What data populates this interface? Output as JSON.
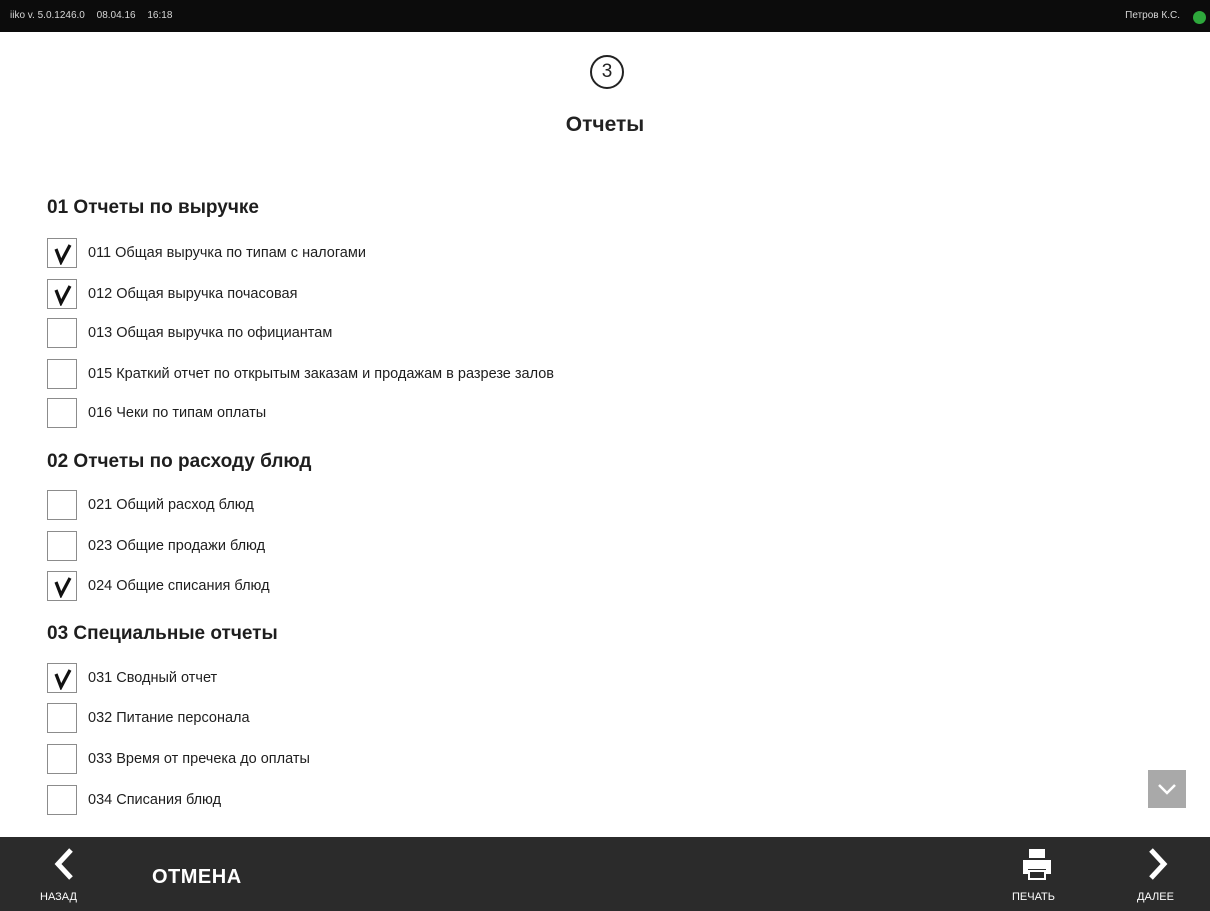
{
  "status_bar": {
    "app_version": "iiko v. 5.0.1246.0",
    "date": "08.04.16",
    "time": "16:18",
    "user": "Петров К.С.",
    "status_color": "#2ea83c"
  },
  "step": {
    "number": "3"
  },
  "page_title": "Отчеты",
  "groups": [
    {
      "title": "01 Отчеты по выручке",
      "items": [
        {
          "label": "011 Общая выручка по типам с налогами",
          "checked": true
        },
        {
          "label": "012 Общая выручка почасовая",
          "checked": true
        },
        {
          "label": "013 Общая выручка по официантам",
          "checked": false
        },
        {
          "label": "015 Краткий отчет по открытым заказам и продажам в разрезе залов",
          "checked": false
        },
        {
          "label": "016 Чеки по типам оплаты",
          "checked": false
        }
      ]
    },
    {
      "title": "02 Отчеты по расходу блюд",
      "items": [
        {
          "label": "021 Общий расход блюд",
          "checked": false
        },
        {
          "label": "023 Общие продажи блюд",
          "checked": false
        },
        {
          "label": "024 Общие списания блюд",
          "checked": true
        }
      ]
    },
    {
      "title": "03 Специальные отчеты",
      "items": [
        {
          "label": "031 Сводный отчет",
          "checked": true
        },
        {
          "label": "032 Питание персонала",
          "checked": false
        },
        {
          "label": "033 Время от пречека до оплаты",
          "checked": false
        },
        {
          "label": "034 Списания блюд",
          "checked": false
        }
      ]
    }
  ],
  "scroll_down_icon": "chevron-down-icon",
  "bottom_bar": {
    "back_label": "НАЗАД",
    "back_icon": "chevron-left-icon",
    "cancel_label": "ОТМЕНА",
    "print_label": "ПЕЧАТЬ",
    "print_icon": "printer-icon",
    "next_label": "ДАЛЕЕ",
    "next_icon": "chevron-right-icon"
  }
}
